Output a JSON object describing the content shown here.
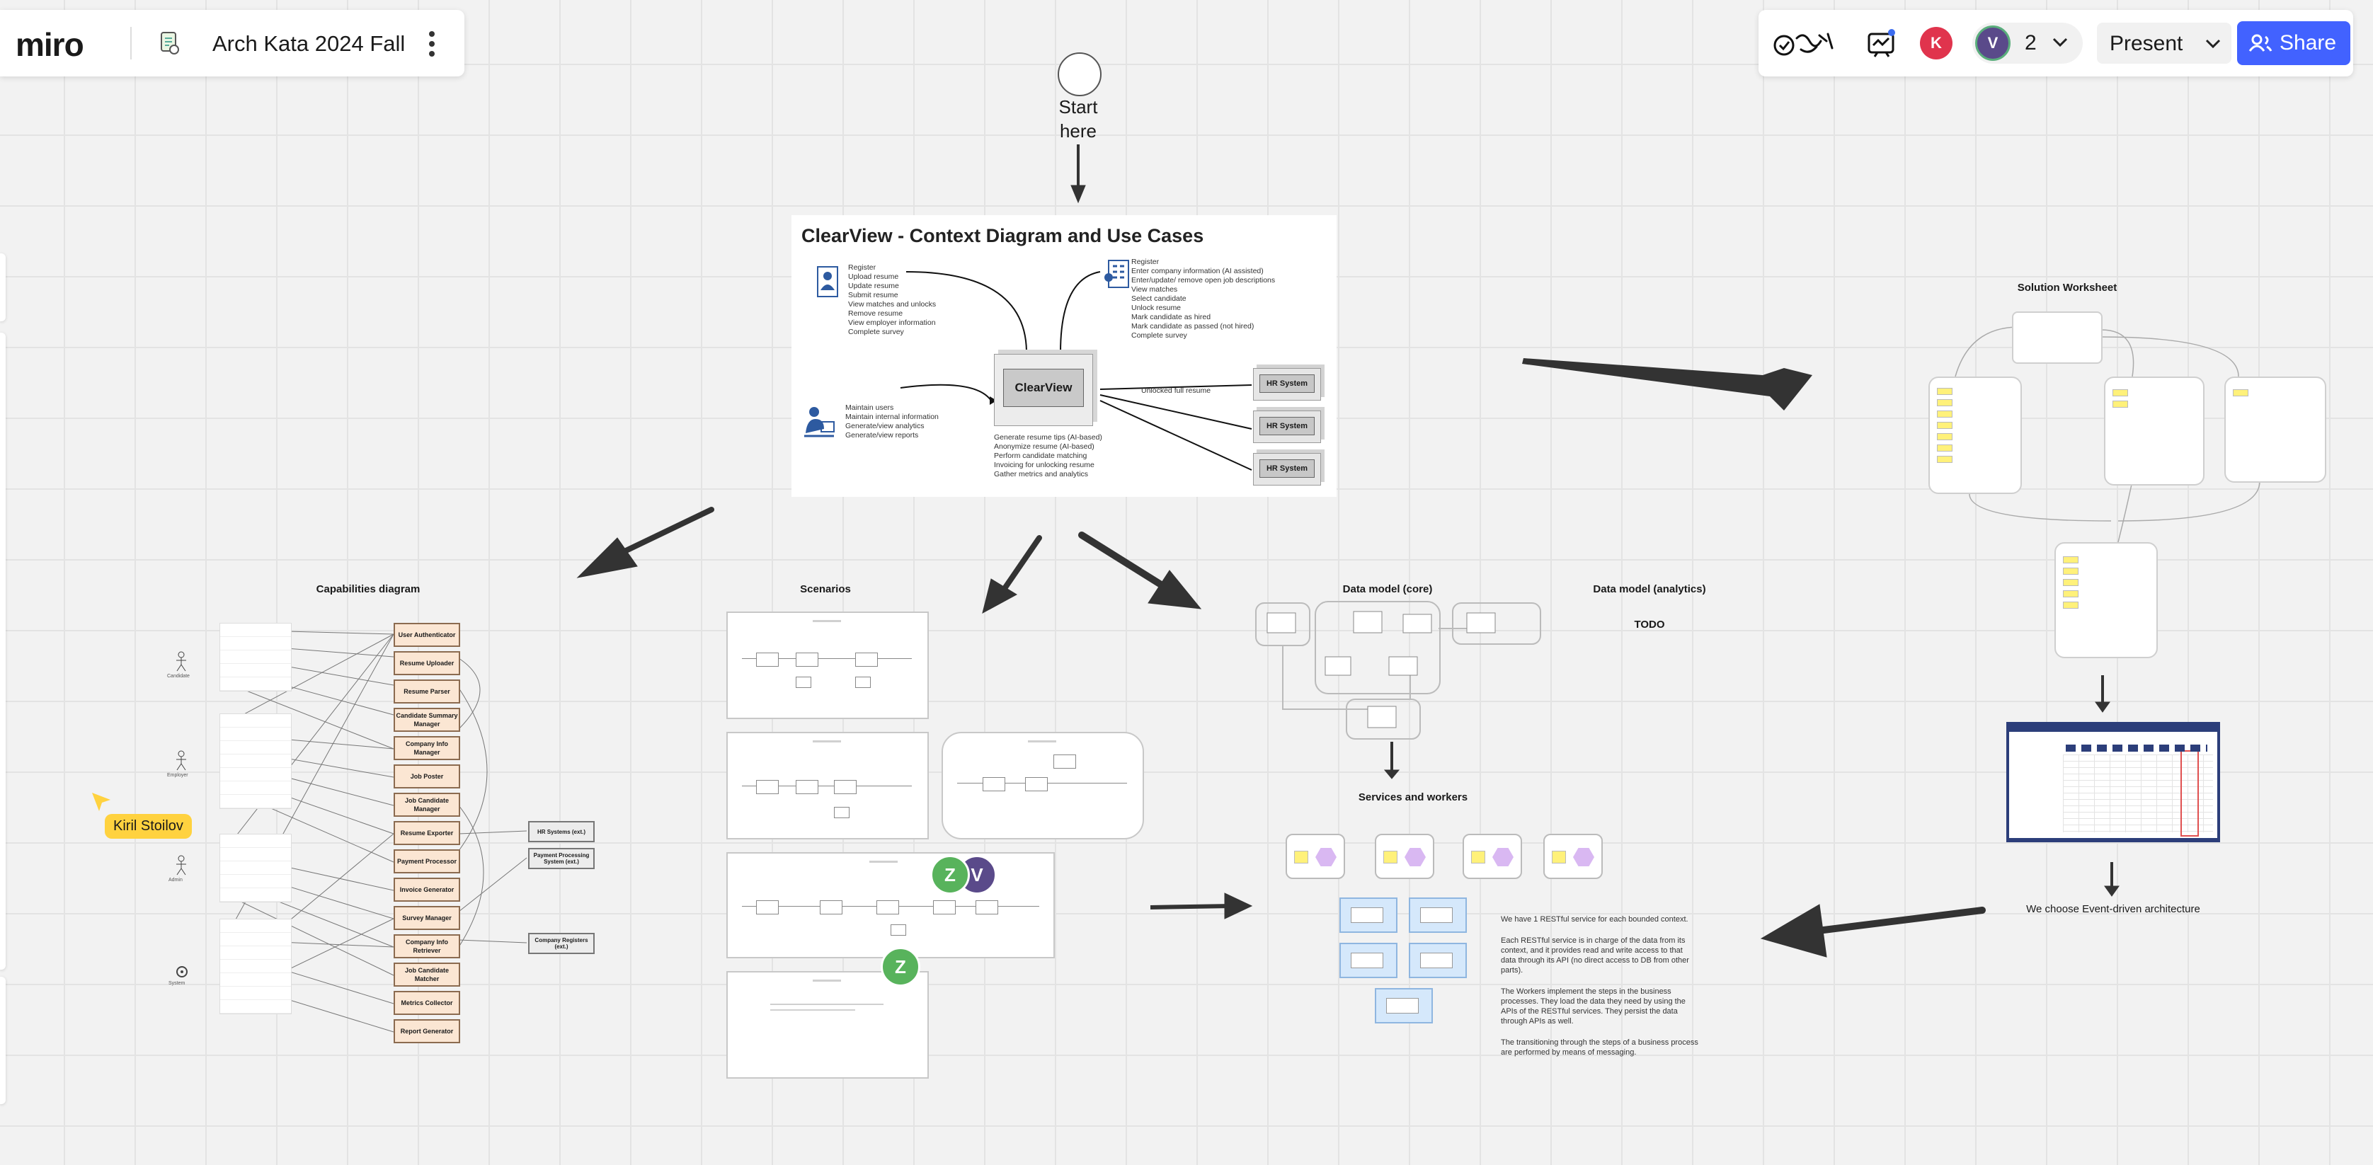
{
  "app": {
    "logo": "miro",
    "board_title": "Arch Kata 2024 Fall"
  },
  "toolbar": {
    "participant_count": "2",
    "present_label": "Present",
    "share_label": "Share",
    "avatar_k": "K",
    "avatar_v": "V"
  },
  "start": {
    "label_line1": "Start",
    "label_line2": "here"
  },
  "context": {
    "title": "ClearView - Context Diagram and Use Cases",
    "center_label": "ClearView",
    "candidate_cases": [
      "Register",
      "Upload resume",
      "Update resume",
      "Submit resume",
      "View matches and unlocks",
      "Remove resume",
      "View employer information",
      "Complete survey"
    ],
    "employer_cases": [
      "Register",
      "Enter company information (AI assisted)",
      "Enter/update/ remove open job descriptions",
      "View matches",
      "Select candidate",
      "Unlock resume",
      "Mark candidate as hired",
      "Mark candidate as passed (not hired)",
      "Complete survey"
    ],
    "admin_cases": [
      "Maintain users",
      "Maintain internal information",
      "Generate/view analytics",
      "Generate/view reports"
    ],
    "system_cases": [
      "Generate resume tips (AI-based)",
      "Anonymize resume (AI-based)",
      "Perform candidate matching",
      "Invoicing for unlocking resume",
      "Gather metrics and analytics"
    ],
    "unlocked_label": "Unlocked full resume",
    "hr_systems": [
      "HR System",
      "HR System",
      "HR System"
    ]
  },
  "sections": {
    "capabilities": "Capabilities diagram",
    "scenarios": "Scenarios",
    "data_core": "Data model (core)",
    "data_analytics": "Data model (analytics)",
    "todo": "TODO",
    "services": "Services and workers",
    "solution": "Solution Worksheet",
    "event_driven": "We choose Event-driven architecture"
  },
  "capabilities": {
    "boxes": [
      "User Authenticator",
      "Resume Uploader",
      "Resume Parser",
      "Candidate Summary Manager",
      "Company Info Manager",
      "Job Poster",
      "Job Candidate Manager",
      "Resume Exporter",
      "Payment Processor",
      "Invoice Generator",
      "Survey Manager",
      "Company Info Retriever",
      "Job Candidate Matcher",
      "Metrics Collector",
      "Report Generator"
    ],
    "external": [
      "HR Systems (ext.)",
      "Payment Processing System (ext.)",
      "Company Registers (ext.)"
    ],
    "actors": [
      "Candidate",
      "Employer",
      "Admin",
      "System"
    ]
  },
  "cursor": {
    "name": "Kiril Stoilov"
  },
  "collaborators": {
    "z": "Z",
    "v": "V"
  },
  "services_text": [
    "We have 1 RESTful service for each bounded context.",
    "Each RESTful service is in charge of the data from its context, and it provides read and write access to that data through its API (no direct access to DB from other parts).",
    "The Workers implement the steps in the business processes. They load the data they need by using the APIs of the RESTful services. They persist the data through APIs as well.",
    "The transitioning through the steps of a business process are performed by means of messaging."
  ],
  "colors": {
    "share_blue": "#4262ff",
    "avatar_red": "#e0344d",
    "avatar_purple": "#5a4a8a",
    "collab_green": "#58b35c",
    "cursor_yellow": "#ffd23f"
  }
}
